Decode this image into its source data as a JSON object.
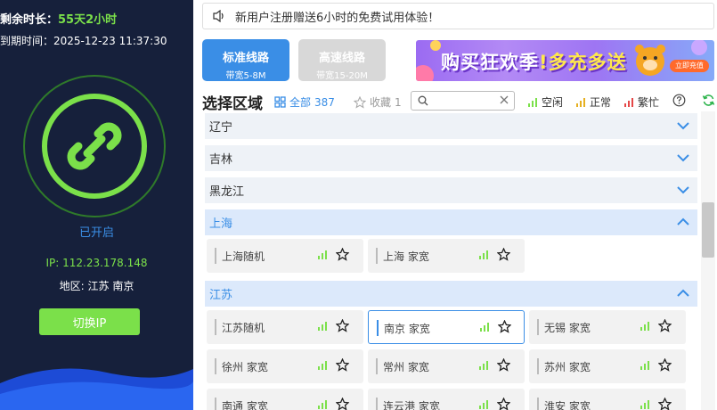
{
  "left": {
    "remain_label": "剩余时长：",
    "remain_value": "55天2小时",
    "expire_label": "到期时间：",
    "expire_value": "2025-12-23 11:37:30",
    "status": "已开启",
    "ip": "IP: 112.23.178.148",
    "region": "地区: 江苏 南京",
    "switch_label": "切换IP"
  },
  "notice": {
    "text": "新用户注册赠送6小时的免费试用体验！"
  },
  "lines": {
    "standard": {
      "title": "标准线路",
      "sub": "带宽5-8M"
    },
    "fast": {
      "title": "高速线路",
      "sub": "带宽15-20M"
    }
  },
  "banner": {
    "text_a": "购买狂欢季",
    "text_b": "多充多送",
    "badge": "立即充值"
  },
  "toolbar": {
    "title": "选择区域",
    "all_label": "全部",
    "all_count": "387",
    "fav_label": "收藏",
    "fav_count": "1",
    "search_placeholder": "",
    "legend": [
      {
        "label": "空闲",
        "color": "#7be04a"
      },
      {
        "label": "正常",
        "color": "#e6b020"
      },
      {
        "label": "繁忙",
        "color": "#e54848"
      }
    ]
  },
  "provinces": [
    {
      "name": "辽宁",
      "expanded": false
    },
    {
      "name": "吉林",
      "expanded": false
    },
    {
      "name": "黑龙江",
      "expanded": false
    },
    {
      "name": "上海",
      "expanded": true,
      "cities": [
        "上海随机",
        "上海 家宽"
      ]
    },
    {
      "name": "江苏",
      "expanded": true,
      "cities": [
        "江苏随机",
        "南京 家宽",
        "无锡 家宽",
        "徐州 家宽",
        "常州 家宽",
        "苏州 家宽",
        "南通 家宽",
        "连云港 家宽",
        "淮安 家宽"
      ]
    }
  ],
  "colors": {
    "accent": "#3a8ee6",
    "green": "#7be04a",
    "panel": "#16203b"
  }
}
